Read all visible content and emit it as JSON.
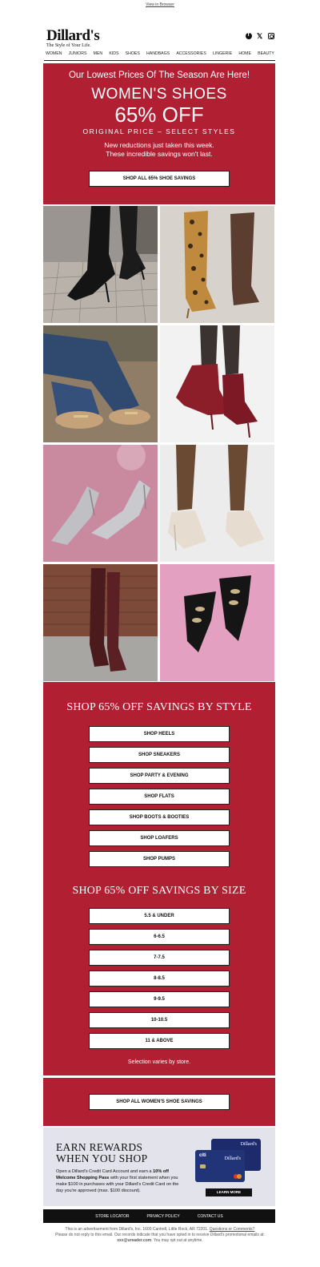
{
  "header": {
    "view_in_browser": "View in Browser",
    "logo_text": "Dillard's",
    "tagline": "The Style of Your Life."
  },
  "nav": [
    "WOMEN",
    "JUNIORS",
    "MEN",
    "KIDS",
    "SHOES",
    "HANDBAGS",
    "ACCESSORIES",
    "LINGERIE",
    "HOME",
    "BEAUTY"
  ],
  "hero": {
    "headline": "Our Lowest Prices Of The Season Are Here!",
    "title": "WOMEN'S SHOES",
    "discount": "65% OFF",
    "subtitle": "ORIGINAL PRICE – SELECT STYLES",
    "body_line1": "New reductions just taken this week.",
    "body_line2": "These incredible savings won't last.",
    "cta": "SHOP ALL 65% SHOE SAVINGS"
  },
  "by_style": {
    "heading": "SHOP 65% OFF SAVINGS BY STYLE",
    "buttons": [
      "SHOP HEELS",
      "SHOP SNEAKERS",
      "SHOP PARTY & EVENING",
      "SHOP FLATS",
      "SHOP BOOTS & BOOTIES",
      "SHOP LOAFERS",
      "SHOP PUMPS"
    ]
  },
  "by_size": {
    "heading": "SHOP 65% OFF SAVINGS BY SIZE",
    "buttons": [
      "5.5 & UNDER",
      "6-6.5",
      "7-7.5",
      "8-8.5",
      "9-9.5",
      "10-10.5",
      "11 & ABOVE"
    ],
    "note": "Selection varies by store."
  },
  "all_savings_cta": "SHOP ALL WOMEN'S SHOE SAVINGS",
  "rewards": {
    "title_line1": "EARN REWARDS",
    "title_line2": "WHEN YOU SHOP",
    "body_pre": "Open a Dillard's Credit Card Account and earn a ",
    "body_bold": "10% off Welcome Shopping Pass",
    "body_post": " with your first statement when you make $100 in purchases with your Dillard's Credit Card on the day you're approved (max. $100 discount).",
    "cta": "LEARN MORE",
    "card_brand": "Dillard's",
    "card_issuer": "citi"
  },
  "footer": {
    "links": [
      "STORE LOCATOR",
      "PRIVACY POLICY",
      "CONTACT US"
    ],
    "legal_1": "This is an advertisement from Dillard's, Inc. 1600 Cantrell, Little Rock, AR 72201.",
    "legal_link": "Questions or Comments?",
    "legal_2": "Please do not reply to this email. Our records indicate that you have opted in to receive Dillard's promotional emails at:",
    "email": "xxx@ureader.com",
    "legal_3": ". You may opt out at anytime."
  },
  "colors": {
    "brand_red": "#b11f33",
    "rewards_bg": "#e3e3ec",
    "footer_bar": "#111111"
  }
}
